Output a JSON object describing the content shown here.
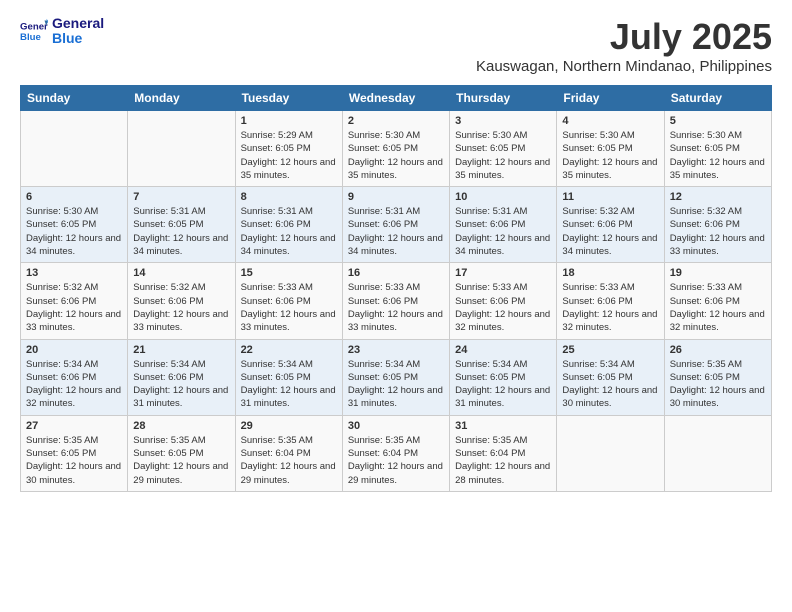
{
  "logo": {
    "line1": "General",
    "line2": "Blue"
  },
  "title": "July 2025",
  "subtitle": "Kauswagan, Northern Mindanao, Philippines",
  "days_of_week": [
    "Sunday",
    "Monday",
    "Tuesday",
    "Wednesday",
    "Thursday",
    "Friday",
    "Saturday"
  ],
  "weeks": [
    [
      {
        "day": "",
        "info": ""
      },
      {
        "day": "",
        "info": ""
      },
      {
        "day": "1",
        "info": "Sunrise: 5:29 AM\nSunset: 6:05 PM\nDaylight: 12 hours and 35 minutes."
      },
      {
        "day": "2",
        "info": "Sunrise: 5:30 AM\nSunset: 6:05 PM\nDaylight: 12 hours and 35 minutes."
      },
      {
        "day": "3",
        "info": "Sunrise: 5:30 AM\nSunset: 6:05 PM\nDaylight: 12 hours and 35 minutes."
      },
      {
        "day": "4",
        "info": "Sunrise: 5:30 AM\nSunset: 6:05 PM\nDaylight: 12 hours and 35 minutes."
      },
      {
        "day": "5",
        "info": "Sunrise: 5:30 AM\nSunset: 6:05 PM\nDaylight: 12 hours and 35 minutes."
      }
    ],
    [
      {
        "day": "6",
        "info": "Sunrise: 5:30 AM\nSunset: 6:05 PM\nDaylight: 12 hours and 34 minutes."
      },
      {
        "day": "7",
        "info": "Sunrise: 5:31 AM\nSunset: 6:05 PM\nDaylight: 12 hours and 34 minutes."
      },
      {
        "day": "8",
        "info": "Sunrise: 5:31 AM\nSunset: 6:06 PM\nDaylight: 12 hours and 34 minutes."
      },
      {
        "day": "9",
        "info": "Sunrise: 5:31 AM\nSunset: 6:06 PM\nDaylight: 12 hours and 34 minutes."
      },
      {
        "day": "10",
        "info": "Sunrise: 5:31 AM\nSunset: 6:06 PM\nDaylight: 12 hours and 34 minutes."
      },
      {
        "day": "11",
        "info": "Sunrise: 5:32 AM\nSunset: 6:06 PM\nDaylight: 12 hours and 34 minutes."
      },
      {
        "day": "12",
        "info": "Sunrise: 5:32 AM\nSunset: 6:06 PM\nDaylight: 12 hours and 33 minutes."
      }
    ],
    [
      {
        "day": "13",
        "info": "Sunrise: 5:32 AM\nSunset: 6:06 PM\nDaylight: 12 hours and 33 minutes."
      },
      {
        "day": "14",
        "info": "Sunrise: 5:32 AM\nSunset: 6:06 PM\nDaylight: 12 hours and 33 minutes."
      },
      {
        "day": "15",
        "info": "Sunrise: 5:33 AM\nSunset: 6:06 PM\nDaylight: 12 hours and 33 minutes."
      },
      {
        "day": "16",
        "info": "Sunrise: 5:33 AM\nSunset: 6:06 PM\nDaylight: 12 hours and 33 minutes."
      },
      {
        "day": "17",
        "info": "Sunrise: 5:33 AM\nSunset: 6:06 PM\nDaylight: 12 hours and 32 minutes."
      },
      {
        "day": "18",
        "info": "Sunrise: 5:33 AM\nSunset: 6:06 PM\nDaylight: 12 hours and 32 minutes."
      },
      {
        "day": "19",
        "info": "Sunrise: 5:33 AM\nSunset: 6:06 PM\nDaylight: 12 hours and 32 minutes."
      }
    ],
    [
      {
        "day": "20",
        "info": "Sunrise: 5:34 AM\nSunset: 6:06 PM\nDaylight: 12 hours and 32 minutes."
      },
      {
        "day": "21",
        "info": "Sunrise: 5:34 AM\nSunset: 6:06 PM\nDaylight: 12 hours and 31 minutes."
      },
      {
        "day": "22",
        "info": "Sunrise: 5:34 AM\nSunset: 6:05 PM\nDaylight: 12 hours and 31 minutes."
      },
      {
        "day": "23",
        "info": "Sunrise: 5:34 AM\nSunset: 6:05 PM\nDaylight: 12 hours and 31 minutes."
      },
      {
        "day": "24",
        "info": "Sunrise: 5:34 AM\nSunset: 6:05 PM\nDaylight: 12 hours and 31 minutes."
      },
      {
        "day": "25",
        "info": "Sunrise: 5:34 AM\nSunset: 6:05 PM\nDaylight: 12 hours and 30 minutes."
      },
      {
        "day": "26",
        "info": "Sunrise: 5:35 AM\nSunset: 6:05 PM\nDaylight: 12 hours and 30 minutes."
      }
    ],
    [
      {
        "day": "27",
        "info": "Sunrise: 5:35 AM\nSunset: 6:05 PM\nDaylight: 12 hours and 30 minutes."
      },
      {
        "day": "28",
        "info": "Sunrise: 5:35 AM\nSunset: 6:05 PM\nDaylight: 12 hours and 29 minutes."
      },
      {
        "day": "29",
        "info": "Sunrise: 5:35 AM\nSunset: 6:04 PM\nDaylight: 12 hours and 29 minutes."
      },
      {
        "day": "30",
        "info": "Sunrise: 5:35 AM\nSunset: 6:04 PM\nDaylight: 12 hours and 29 minutes."
      },
      {
        "day": "31",
        "info": "Sunrise: 5:35 AM\nSunset: 6:04 PM\nDaylight: 12 hours and 28 minutes."
      },
      {
        "day": "",
        "info": ""
      },
      {
        "day": "",
        "info": ""
      }
    ]
  ]
}
